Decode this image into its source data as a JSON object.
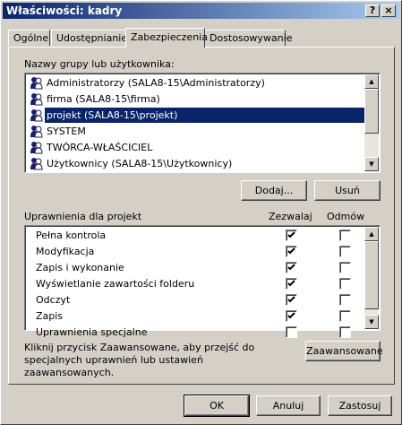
{
  "window": {
    "title": "Właściwości: kadry",
    "help_label": "?",
    "close_label": "×"
  },
  "tabs": [
    {
      "label": "Ogólne"
    },
    {
      "label": "Udostępnianie"
    },
    {
      "label": "Zabezpieczenia",
      "active": true
    },
    {
      "label": "Dostosowywanie"
    }
  ],
  "users": {
    "heading": "Nazwy grupy lub użytkownika:",
    "items": [
      {
        "label": "Administratorzy (SALA8-15\\Administratorzy)"
      },
      {
        "label": "firma (SALA8-15\\firma)"
      },
      {
        "label": "projekt (SALA8-15\\projekt)",
        "selected": true
      },
      {
        "label": "SYSTEM"
      },
      {
        "label": "TWÓRCA-WŁAŚCICIEL"
      },
      {
        "label": "Użytkownicy (SALA8-15\\Użytkownicy)"
      }
    ],
    "add_label": "Dodaj...",
    "remove_label": "Usuń"
  },
  "permissions": {
    "heading": "Uprawnienia dla projekt",
    "allow_header": "Zezwalaj",
    "deny_header": "Odmów",
    "rows": [
      {
        "name": "Pełna kontrola",
        "allow": true,
        "deny": false
      },
      {
        "name": "Modyfikacja",
        "allow": true,
        "deny": false
      },
      {
        "name": "Zapis i wykonanie",
        "allow": true,
        "deny": false
      },
      {
        "name": "Wyświetlanie zawartości folderu",
        "allow": true,
        "deny": false
      },
      {
        "name": "Odczyt",
        "allow": true,
        "deny": false
      },
      {
        "name": "Zapis",
        "allow": true,
        "deny": false
      },
      {
        "name": "Uprawnienia specjalne",
        "allow": false,
        "deny": false
      }
    ]
  },
  "advanced": {
    "text_line1": "Kliknij przycisk Zaawansowane, aby przejść do",
    "text_line2": "specjalnych uprawnień lub ustawień",
    "text_line3": "zaawansowanych.",
    "button_label": "Zaawansowane"
  },
  "footer": {
    "ok_label": "OK",
    "cancel_label": "Anuluj",
    "apply_label": "Zastosuj"
  }
}
